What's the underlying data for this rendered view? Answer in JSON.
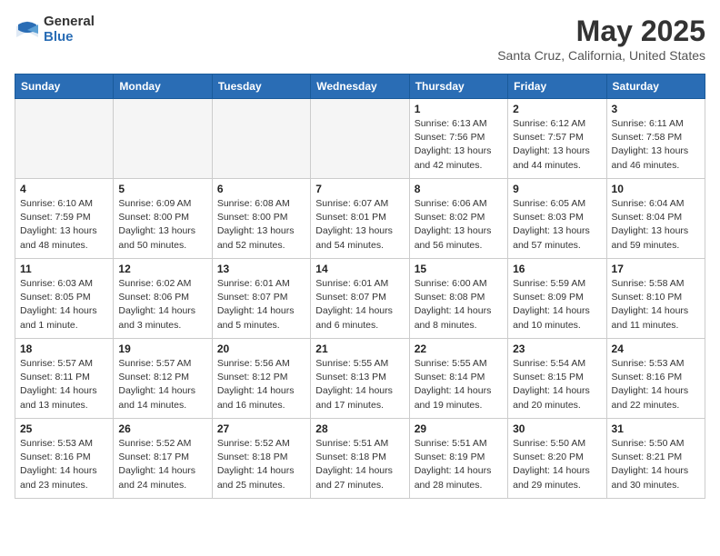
{
  "header": {
    "logo_general": "General",
    "logo_blue": "Blue",
    "month_year": "May 2025",
    "location": "Santa Cruz, California, United States"
  },
  "weekdays": [
    "Sunday",
    "Monday",
    "Tuesday",
    "Wednesday",
    "Thursday",
    "Friday",
    "Saturday"
  ],
  "weeks": [
    [
      {
        "day": "",
        "detail": ""
      },
      {
        "day": "",
        "detail": ""
      },
      {
        "day": "",
        "detail": ""
      },
      {
        "day": "",
        "detail": ""
      },
      {
        "day": "1",
        "detail": "Sunrise: 6:13 AM\nSunset: 7:56 PM\nDaylight: 13 hours\nand 42 minutes."
      },
      {
        "day": "2",
        "detail": "Sunrise: 6:12 AM\nSunset: 7:57 PM\nDaylight: 13 hours\nand 44 minutes."
      },
      {
        "day": "3",
        "detail": "Sunrise: 6:11 AM\nSunset: 7:58 PM\nDaylight: 13 hours\nand 46 minutes."
      }
    ],
    [
      {
        "day": "4",
        "detail": "Sunrise: 6:10 AM\nSunset: 7:59 PM\nDaylight: 13 hours\nand 48 minutes."
      },
      {
        "day": "5",
        "detail": "Sunrise: 6:09 AM\nSunset: 8:00 PM\nDaylight: 13 hours\nand 50 minutes."
      },
      {
        "day": "6",
        "detail": "Sunrise: 6:08 AM\nSunset: 8:00 PM\nDaylight: 13 hours\nand 52 minutes."
      },
      {
        "day": "7",
        "detail": "Sunrise: 6:07 AM\nSunset: 8:01 PM\nDaylight: 13 hours\nand 54 minutes."
      },
      {
        "day": "8",
        "detail": "Sunrise: 6:06 AM\nSunset: 8:02 PM\nDaylight: 13 hours\nand 56 minutes."
      },
      {
        "day": "9",
        "detail": "Sunrise: 6:05 AM\nSunset: 8:03 PM\nDaylight: 13 hours\nand 57 minutes."
      },
      {
        "day": "10",
        "detail": "Sunrise: 6:04 AM\nSunset: 8:04 PM\nDaylight: 13 hours\nand 59 minutes."
      }
    ],
    [
      {
        "day": "11",
        "detail": "Sunrise: 6:03 AM\nSunset: 8:05 PM\nDaylight: 14 hours\nand 1 minute."
      },
      {
        "day": "12",
        "detail": "Sunrise: 6:02 AM\nSunset: 8:06 PM\nDaylight: 14 hours\nand 3 minutes."
      },
      {
        "day": "13",
        "detail": "Sunrise: 6:01 AM\nSunset: 8:07 PM\nDaylight: 14 hours\nand 5 minutes."
      },
      {
        "day": "14",
        "detail": "Sunrise: 6:01 AM\nSunset: 8:07 PM\nDaylight: 14 hours\nand 6 minutes."
      },
      {
        "day": "15",
        "detail": "Sunrise: 6:00 AM\nSunset: 8:08 PM\nDaylight: 14 hours\nand 8 minutes."
      },
      {
        "day": "16",
        "detail": "Sunrise: 5:59 AM\nSunset: 8:09 PM\nDaylight: 14 hours\nand 10 minutes."
      },
      {
        "day": "17",
        "detail": "Sunrise: 5:58 AM\nSunset: 8:10 PM\nDaylight: 14 hours\nand 11 minutes."
      }
    ],
    [
      {
        "day": "18",
        "detail": "Sunrise: 5:57 AM\nSunset: 8:11 PM\nDaylight: 14 hours\nand 13 minutes."
      },
      {
        "day": "19",
        "detail": "Sunrise: 5:57 AM\nSunset: 8:12 PM\nDaylight: 14 hours\nand 14 minutes."
      },
      {
        "day": "20",
        "detail": "Sunrise: 5:56 AM\nSunset: 8:12 PM\nDaylight: 14 hours\nand 16 minutes."
      },
      {
        "day": "21",
        "detail": "Sunrise: 5:55 AM\nSunset: 8:13 PM\nDaylight: 14 hours\nand 17 minutes."
      },
      {
        "day": "22",
        "detail": "Sunrise: 5:55 AM\nSunset: 8:14 PM\nDaylight: 14 hours\nand 19 minutes."
      },
      {
        "day": "23",
        "detail": "Sunrise: 5:54 AM\nSunset: 8:15 PM\nDaylight: 14 hours\nand 20 minutes."
      },
      {
        "day": "24",
        "detail": "Sunrise: 5:53 AM\nSunset: 8:16 PM\nDaylight: 14 hours\nand 22 minutes."
      }
    ],
    [
      {
        "day": "25",
        "detail": "Sunrise: 5:53 AM\nSunset: 8:16 PM\nDaylight: 14 hours\nand 23 minutes."
      },
      {
        "day": "26",
        "detail": "Sunrise: 5:52 AM\nSunset: 8:17 PM\nDaylight: 14 hours\nand 24 minutes."
      },
      {
        "day": "27",
        "detail": "Sunrise: 5:52 AM\nSunset: 8:18 PM\nDaylight: 14 hours\nand 25 minutes."
      },
      {
        "day": "28",
        "detail": "Sunrise: 5:51 AM\nSunset: 8:18 PM\nDaylight: 14 hours\nand 27 minutes."
      },
      {
        "day": "29",
        "detail": "Sunrise: 5:51 AM\nSunset: 8:19 PM\nDaylight: 14 hours\nand 28 minutes."
      },
      {
        "day": "30",
        "detail": "Sunrise: 5:50 AM\nSunset: 8:20 PM\nDaylight: 14 hours\nand 29 minutes."
      },
      {
        "day": "31",
        "detail": "Sunrise: 5:50 AM\nSunset: 8:21 PM\nDaylight: 14 hours\nand 30 minutes."
      }
    ]
  ]
}
